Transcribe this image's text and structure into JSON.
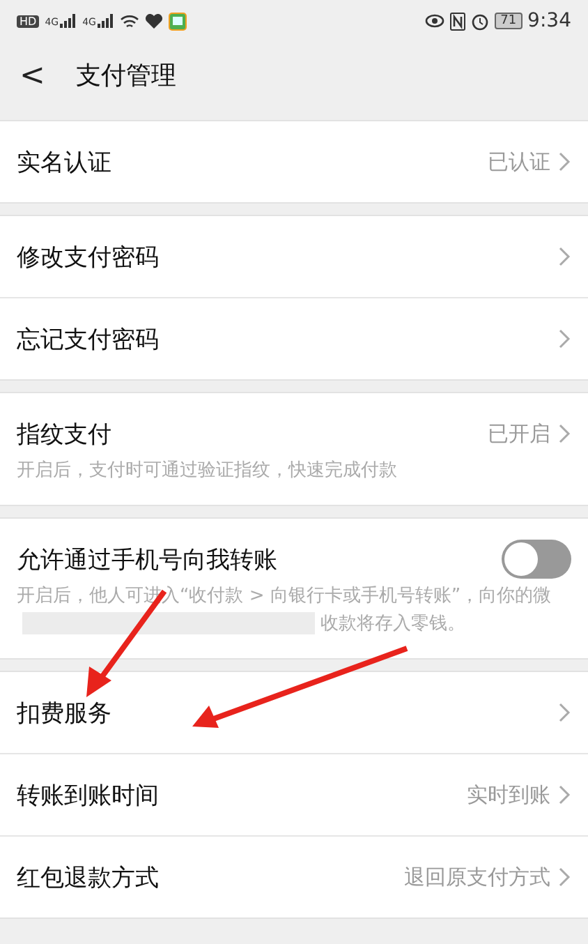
{
  "status_bar": {
    "hd": "HD",
    "signals": [
      "4G",
      "4G"
    ],
    "battery": "71",
    "time": "9:34"
  },
  "header": {
    "back": "<",
    "title": "支付管理"
  },
  "sections": [
    {
      "rows": [
        {
          "kind": "link",
          "label": "实名认证",
          "value": "已认证"
        }
      ]
    },
    {
      "rows": [
        {
          "kind": "link",
          "label": "修改支付密码"
        },
        {
          "kind": "link",
          "label": "忘记支付密码"
        }
      ]
    },
    {
      "rows": [
        {
          "kind": "link",
          "label": "指纹支付",
          "value": "已开启",
          "note": "开启后，支付时可通过验证指纹，快速完成付款"
        }
      ]
    },
    {
      "rows": [
        {
          "kind": "toggle",
          "label": "允许通过手机号向我转账",
          "on": false,
          "note": "开启后，他人可进入“收付款 > 向银行卡或手机号转账”，向你的微",
          "note_after": "收款将存入零钱。"
        }
      ]
    },
    {
      "rows": [
        {
          "kind": "link",
          "label": "扣费服务"
        },
        {
          "kind": "link",
          "label": "转账到账时间",
          "value": "实时到账"
        },
        {
          "kind": "link",
          "label": "红包退款方式",
          "value": "退回原支付方式"
        }
      ]
    }
  ]
}
